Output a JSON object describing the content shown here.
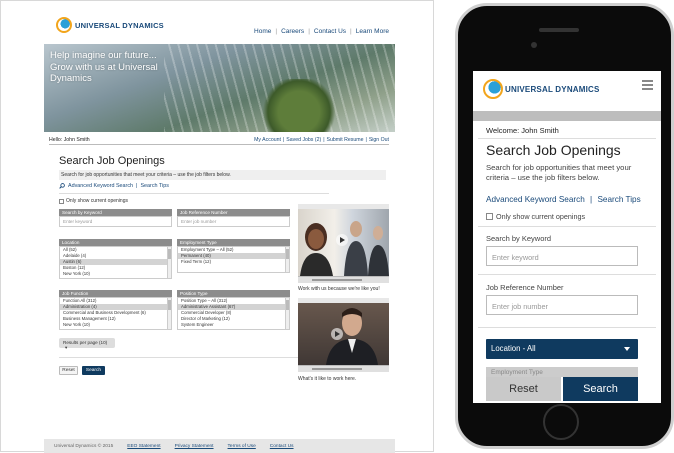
{
  "brand": "Universal Dynamics",
  "desktop": {
    "brand_label": "UNIVERSAL DYNAMICS",
    "nav": [
      "Home",
      "Careers",
      "Contact Us",
      "Learn More"
    ],
    "hero_lines": [
      "Help imagine our future...",
      "Grow with us at Universal",
      "Dynamics"
    ],
    "hello": "Hello: John Smith",
    "account_links": [
      "My Account",
      "Saved Jobs (2)",
      "Submit Resume",
      "Sign Out"
    ],
    "title": "Search Job Openings",
    "subtitle": "Search for job opportunities that meet your criteria – use the job filters below.",
    "advanced": "Advanced Keyword Search",
    "tips": "Search Tips",
    "only_current": "Only show current openings",
    "keyword_label": "Search by Keyword",
    "keyword_placeholder": "Enter keyword",
    "ref_label": "Job Reference Number",
    "ref_placeholder": "Enter job number",
    "location_label": "Location",
    "location_options": [
      "All (52)",
      "Adelaide (4)",
      "Austin (6)",
      "Boston (12)",
      "New York (10)"
    ],
    "location_selected": 2,
    "employment_label": "Employment Type",
    "employment_options": [
      "Employment Type – All (52)",
      "Permanent (40)",
      "Fixed Term (12)"
    ],
    "employment_selected": 1,
    "function_label": "Job Function",
    "function_options": [
      "Function All (312)",
      "Administration (4)",
      "Commercial and Business Development (6)",
      "Business Management (12)",
      "New York (10)"
    ],
    "function_selected": 1,
    "position_label": "Position Type",
    "position_options": [
      "Position Type – All (312)",
      "Administrative Assistant (67)",
      "Commercial Developer (8)",
      "Director of Marketing (12)",
      "System Engineer"
    ],
    "position_selected": 1,
    "results_per_page": "Results per page (10)",
    "reset": "Reset",
    "search": "Search",
    "video1_caption": "Work with us because we're like you!",
    "video2_caption": "What's it like to work here.",
    "footer": {
      "copyright": "Universal Dynamics © 2015",
      "links": [
        "EEO Statement",
        "Privacy Statement",
        "Terms of Use",
        "Contact Us"
      ]
    }
  },
  "mobile": {
    "brand_label": "UNIVERSAL DYNAMICS",
    "welcome": "Welcome: John Smith",
    "title": "Search Job Openings",
    "subtitle": "Search for job opportunities that meet your criteria – use the job filters below.",
    "advanced": "Advanced Keyword Search",
    "separator": "|",
    "tips": "Search Tips",
    "only_current": "Only show current openings",
    "keyword_label": "Search by Keyword",
    "keyword_placeholder": "Enter keyword",
    "ref_label": "Job Reference Number",
    "ref_placeholder": "Enter job number",
    "location": "Location - All",
    "employment": "Employment Type",
    "reset": "Reset",
    "search": "Search"
  },
  "colors": {
    "brand_navy": "#0f3a5f",
    "link_blue": "#1a4a7a",
    "logo_orange": "#f2a51c",
    "logo_blue": "#2aa0d8"
  }
}
